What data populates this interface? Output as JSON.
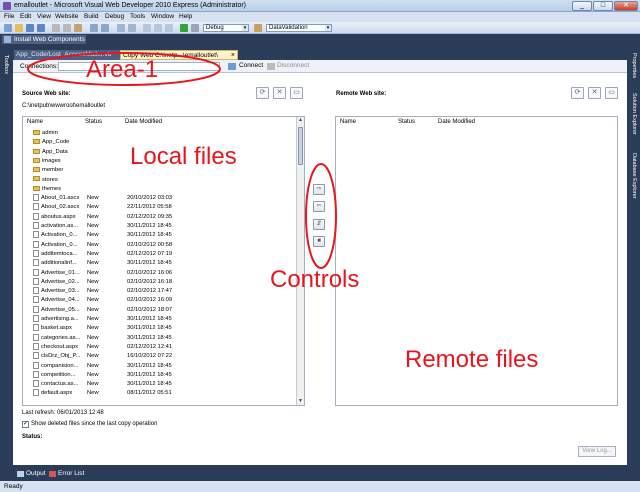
{
  "window": {
    "title": "emalloutlet - Microsoft Visual Web Developer 2010 Express (Administrator)",
    "min": "_",
    "max": "□",
    "close": "✕"
  },
  "menu": [
    "File",
    "Edit",
    "View",
    "Website",
    "Build",
    "Debug",
    "Tools",
    "Window",
    "Help"
  ],
  "toolbar": {
    "config": "Debug",
    "config_arrow": "▾",
    "startup": "DataValidation",
    "startup_arrow": "▾"
  },
  "install_tab": "Install Web Components",
  "doc_tabs": {
    "tab1": "App_Code/Lost_AccessMailer.vb",
    "tab2": "Copy Web C:\\inetp...\\emalloutlet\\",
    "close": "×"
  },
  "side_left": [
    "Toolbox"
  ],
  "side_right": [
    "Properties",
    "Solution Explorer",
    "Database Explorer"
  ],
  "connection": {
    "label": "Connections:",
    "connect": "Connect",
    "disconnect": "Disconnect"
  },
  "source": {
    "label": "Source Web site:",
    "path": "C:\\inetpub\\wwwroot\\emalloutlet"
  },
  "remote": {
    "label": "Remote Web site:"
  },
  "columns": {
    "name": "Name",
    "status": "Status",
    "date": "Date Modified"
  },
  "folders": [
    "admin",
    "App_Code",
    "App_Data",
    "images",
    "member",
    "stores",
    "themes"
  ],
  "files": [
    {
      "name": "About_01.ascx",
      "status": "New",
      "date": "20/10/2012 03:03"
    },
    {
      "name": "About_02.ascx",
      "status": "New",
      "date": "22/11/2012 05:58"
    },
    {
      "name": "aboutus.aspx",
      "status": "New",
      "date": "02/12/2012 09:35"
    },
    {
      "name": "activation.as...",
      "status": "New",
      "date": "30/11/2012 18:45"
    },
    {
      "name": "Activation_0...",
      "status": "New",
      "date": "30/11/2012 18:45"
    },
    {
      "name": "Activation_0...",
      "status": "New",
      "date": "02/10/2012 00:58"
    },
    {
      "name": "additemtoca...",
      "status": "New",
      "date": "02/12/2012 07:19"
    },
    {
      "name": "additionalinf...",
      "status": "New",
      "date": "30/11/2012 18:45"
    },
    {
      "name": "Advertise_01...",
      "status": "New",
      "date": "02/10/2012 16:06"
    },
    {
      "name": "Advertise_02...",
      "status": "New",
      "date": "02/10/2012 16:18"
    },
    {
      "name": "Advertise_03...",
      "status": "New",
      "date": "02/10/2012 17:47"
    },
    {
      "name": "Advertise_04...",
      "status": "New",
      "date": "02/10/2012 16:09"
    },
    {
      "name": "Advertise_05...",
      "status": "New",
      "date": "02/10/2012 18:07"
    },
    {
      "name": "advertising.a...",
      "status": "New",
      "date": "30/11/2012 18:45"
    },
    {
      "name": "basket.aspx",
      "status": "New",
      "date": "30/11/2012 18:45"
    },
    {
      "name": "categories.as...",
      "status": "New",
      "date": "30/11/2012 18:45"
    },
    {
      "name": "checkout.aspx",
      "status": "New",
      "date": "02/12/2012 12:41"
    },
    {
      "name": "clsDrz_Obj_P...",
      "status": "New",
      "date": "16/10/2012 07:22"
    },
    {
      "name": "companision...",
      "status": "New",
      "date": "30/11/2012 18:45"
    },
    {
      "name": "competition...",
      "status": "New",
      "date": "30/11/2012 18:45"
    },
    {
      "name": "contactus.as...",
      "status": "New",
      "date": "30/11/2012 18:45"
    },
    {
      "name": "default.aspx",
      "status": "New",
      "date": "08/11/2012 05:51"
    }
  ],
  "controls": {
    "copy_right": "⇨",
    "copy_left": "⇦",
    "sync": "⇵",
    "stop": "■"
  },
  "pane_buttons": {
    "refresh": "⟳",
    "cancel": "✕",
    "view": "▭"
  },
  "scroll_up": "▲",
  "scroll_down": "▼",
  "footer": {
    "last_refresh": "Last refresh: 06/01/2013 12:48",
    "show_deleted": "Show deleted files since the last copy operation",
    "status": "Status:",
    "view_log": "View Log..."
  },
  "bottom_tabs": {
    "output": "Output",
    "error_list": "Error List"
  },
  "statusbar": "Ready",
  "annotations": {
    "area1": "Area-1",
    "local": "Local files",
    "controls": "Controls",
    "remote": "Remote files"
  },
  "colors": {
    "annotation": "#e8161b",
    "ide_dark": "#2b3c59",
    "folder": "#e6c35a"
  }
}
